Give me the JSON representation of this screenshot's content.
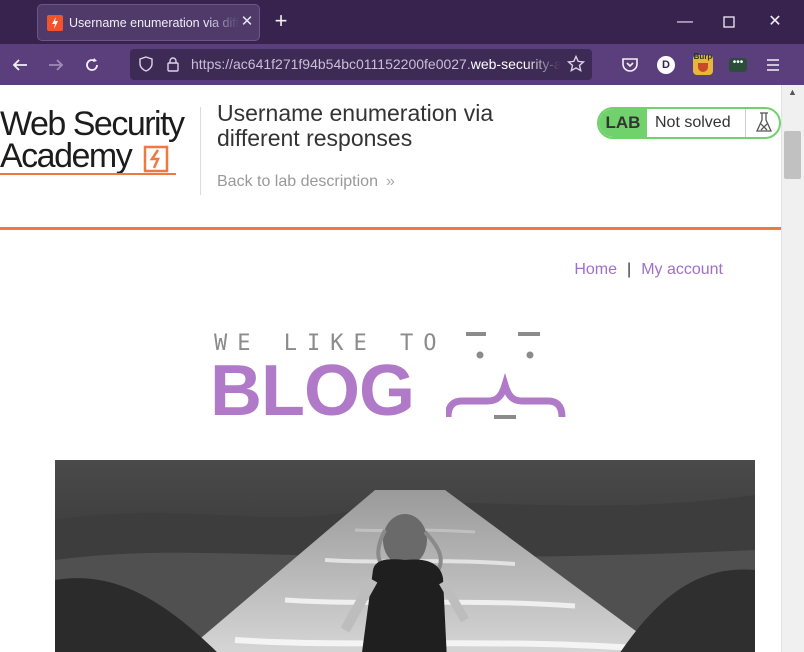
{
  "browser": {
    "tab_title": "Username enumeration via different responses",
    "url_prefix": "https://ac641f271f94b54bc011152200fe0027.",
    "url_host": "web-security-academy.net",
    "account_initial": "D",
    "extension_label": "Burp"
  },
  "lab": {
    "logo_line1": "Web Security",
    "logo_line2": "Academy",
    "title": "Username enumeration via different responses",
    "back_link": "Back to lab description",
    "status_badge": "LAB",
    "status_text": "Not solved"
  },
  "nav": {
    "home": "Home",
    "separator": "|",
    "my_account": "My account"
  },
  "banner": {
    "small": "WE LIKE TO",
    "big": "BLOG"
  },
  "colors": {
    "accent_orange": "#ee7941",
    "status_green": "#70d16d",
    "link_purple": "#a070c8",
    "blog_purple": "#b07ac8",
    "browser_tabbar": "#38234f",
    "browser_nav": "#5b3f7d"
  },
  "icons": {
    "back": "arrow-left-icon",
    "forward": "arrow-right-icon",
    "reload": "reload-icon",
    "shield": "shield-icon",
    "lock": "lock-icon",
    "bookmark": "star-icon",
    "pocket": "pocket-icon",
    "menu": "hamburger-icon",
    "flask": "flask-icon"
  }
}
